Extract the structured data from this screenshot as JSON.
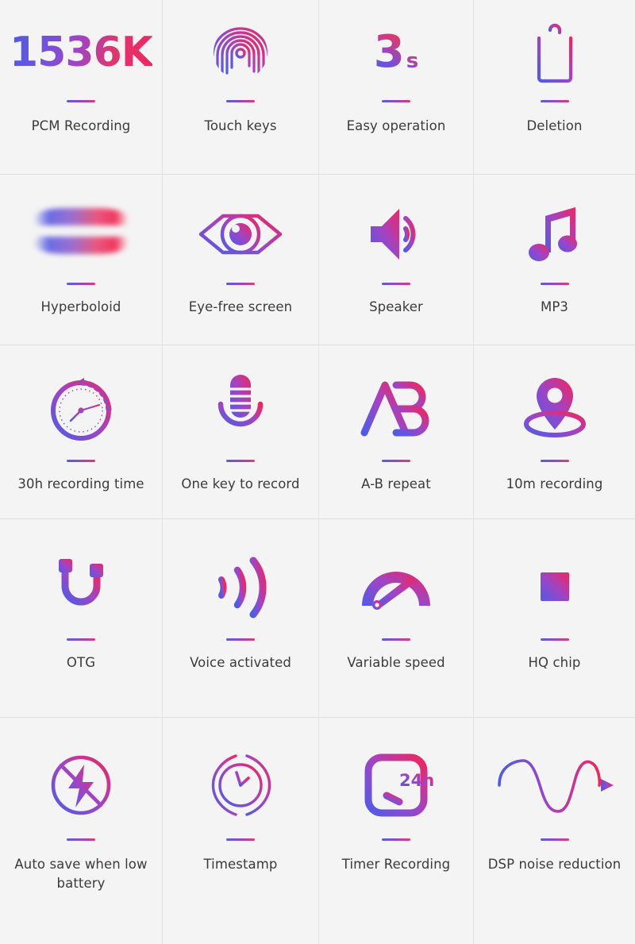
{
  "page": {
    "title": "Voice Recorder Feature Grid",
    "background_color": "#f4f4f4",
    "text_color": "#3b3b3b",
    "gradient_start": "#4f5be8",
    "gradient_mid": "#a044c4",
    "gradient_end": "#f2255e",
    "columns": 4,
    "rows": 5
  },
  "features": [
    {
      "id": "pcm-recording",
      "label": "PCM Recording",
      "icon": "big-text-1536k-icon",
      "value_text": "1536K"
    },
    {
      "id": "touch-keys",
      "label": "Touch keys",
      "icon": "fingerprint-icon"
    },
    {
      "id": "easy-operation",
      "label": "Easy operation",
      "icon": "three-seconds-icon",
      "value_text": "3",
      "unit_text": "s"
    },
    {
      "id": "deletion",
      "label": "Deletion",
      "icon": "trash-can-icon"
    },
    {
      "id": "hyperboloid",
      "label": "Hyperboloid",
      "icon": "curved-surface-icon"
    },
    {
      "id": "eye-free-screen",
      "label": "Eye-free screen",
      "icon": "eye-icon"
    },
    {
      "id": "speaker",
      "label": "Speaker",
      "icon": "speaker-icon"
    },
    {
      "id": "mp3",
      "label": "MP3",
      "icon": "music-note-icon"
    },
    {
      "id": "recording-time",
      "label": "30h recording time",
      "icon": "stopwatch-clock-icon"
    },
    {
      "id": "one-key-record",
      "label": "One key to record",
      "icon": "microphone-icon"
    },
    {
      "id": "ab-repeat",
      "label": "A-B repeat",
      "icon": "ab-letters-icon"
    },
    {
      "id": "distance-recording",
      "label": "10m recording",
      "icon": "map-pin-icon"
    },
    {
      "id": "otg",
      "label": "OTG",
      "icon": "magnet-icon"
    },
    {
      "id": "voice-activated",
      "label": "Voice activated",
      "icon": "sound-waves-icon"
    },
    {
      "id": "variable-speed",
      "label": "Variable speed",
      "icon": "speedometer-icon"
    },
    {
      "id": "hq-chip",
      "label": "HQ chip",
      "icon": "cpu-chip-icon"
    },
    {
      "id": "auto-save",
      "label": "Auto save when low battery",
      "icon": "no-power-icon"
    },
    {
      "id": "timestamp",
      "label": "Timestamp",
      "icon": "clock-loop-icon"
    },
    {
      "id": "timer-recording",
      "label": "Timer Recording",
      "icon": "timer-24h-icon",
      "value_text": "24h"
    },
    {
      "id": "dsp-noise",
      "label": "DSP noise reduction",
      "icon": "sine-wave-icon"
    }
  ]
}
